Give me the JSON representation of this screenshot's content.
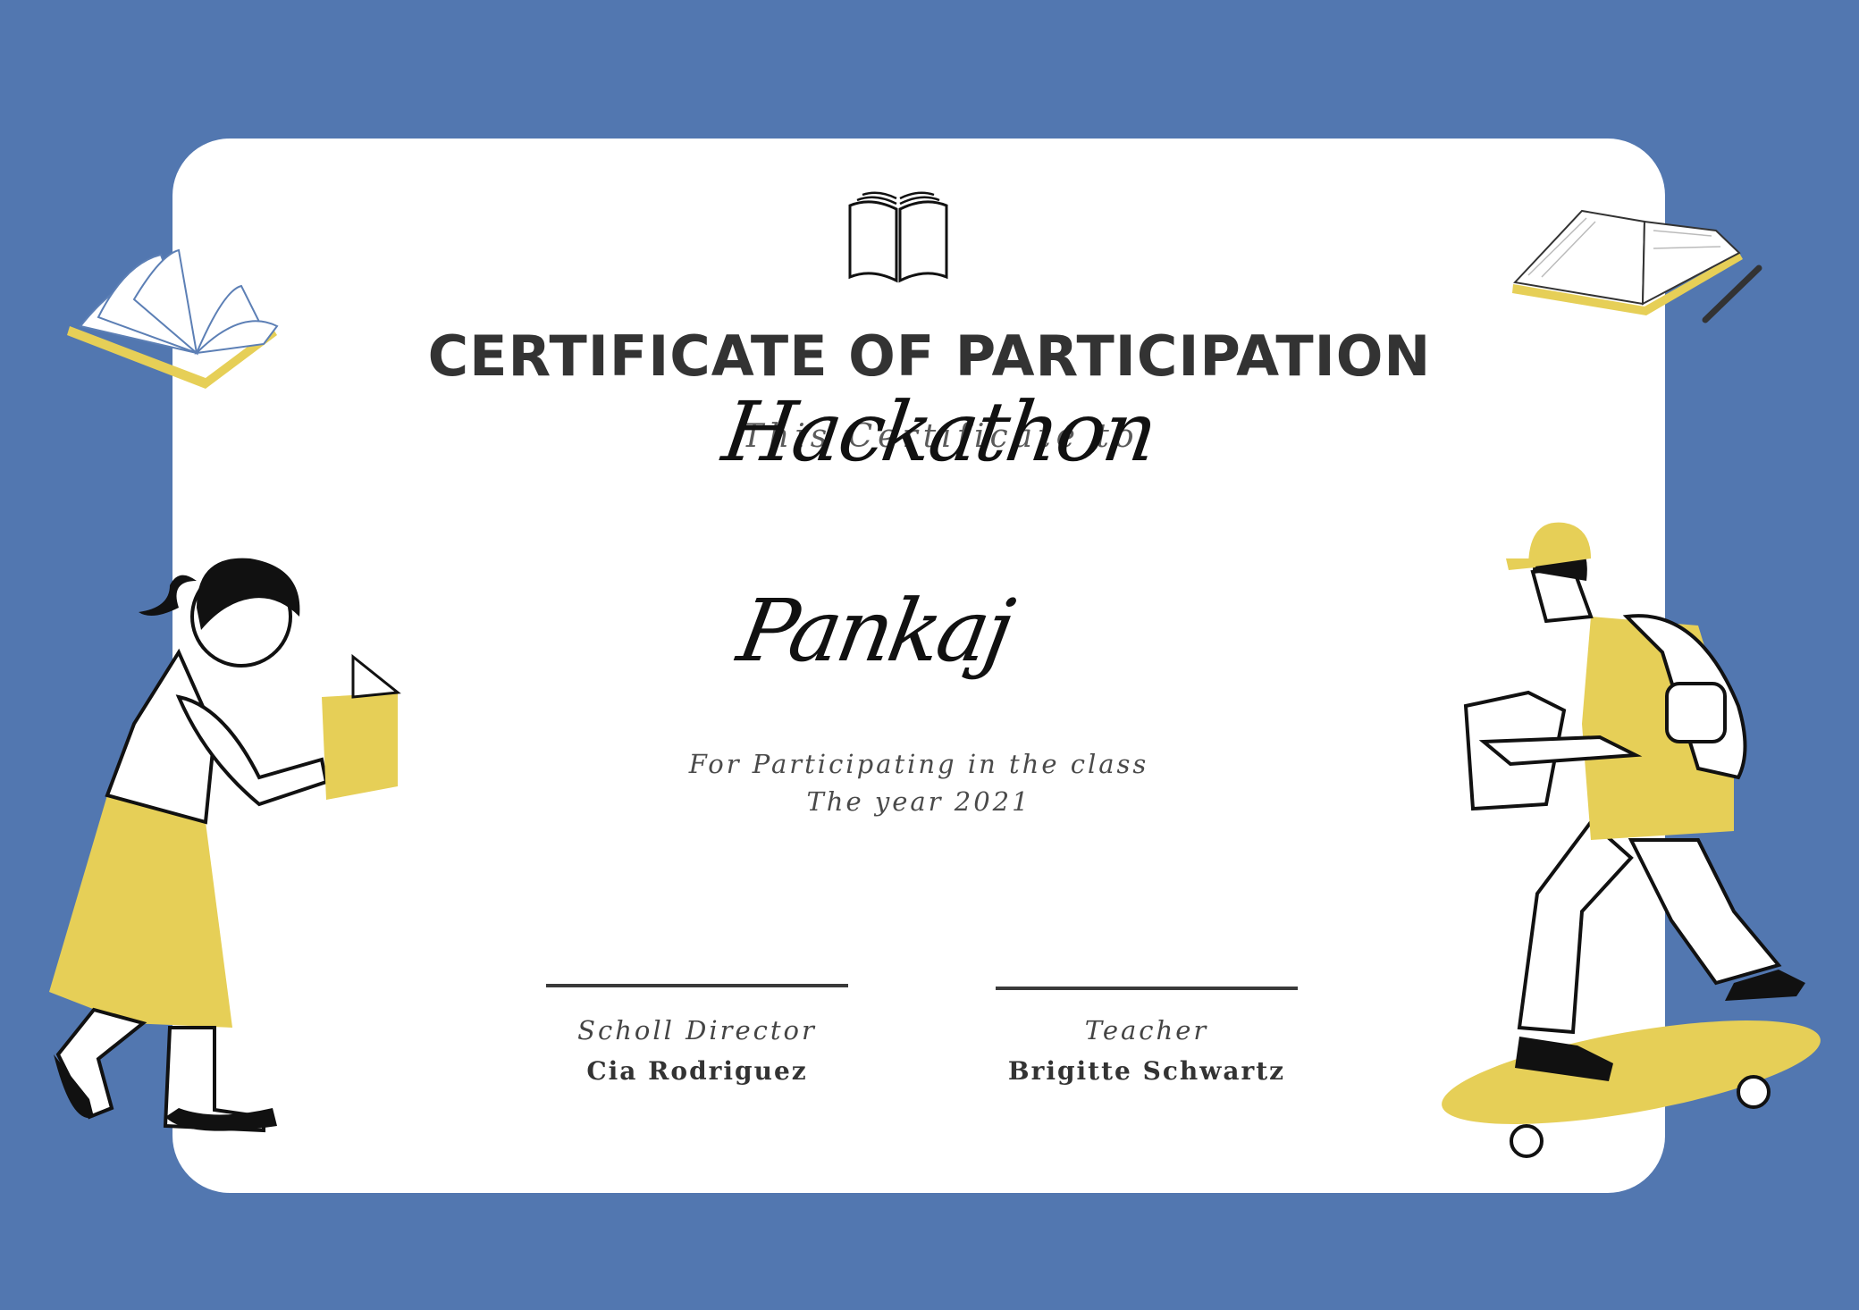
{
  "certificate": {
    "title": "CERTIFICATE OF PARTICIPATION",
    "event_name": "Hackathon",
    "given_to": "This Certificate to",
    "recipient": "Pankaj",
    "description_line1": "For Participating in the class",
    "description_line2": "The year 2021",
    "signatures": [
      {
        "role": "Scholl Director",
        "name": "Cia Rodriguez"
      },
      {
        "role": "Teacher",
        "name": "Brigitte Schwartz"
      }
    ]
  },
  "colors": {
    "background": "#5277b0",
    "card": "#ffffff",
    "accent_yellow": "#e6cf57",
    "ink": "#111111",
    "title": "#333333"
  },
  "icons": [
    "open-book-icon",
    "flying-book-icon",
    "open-book-pen-icon",
    "girl-reading-illustration",
    "boy-skateboard-illustration"
  ]
}
